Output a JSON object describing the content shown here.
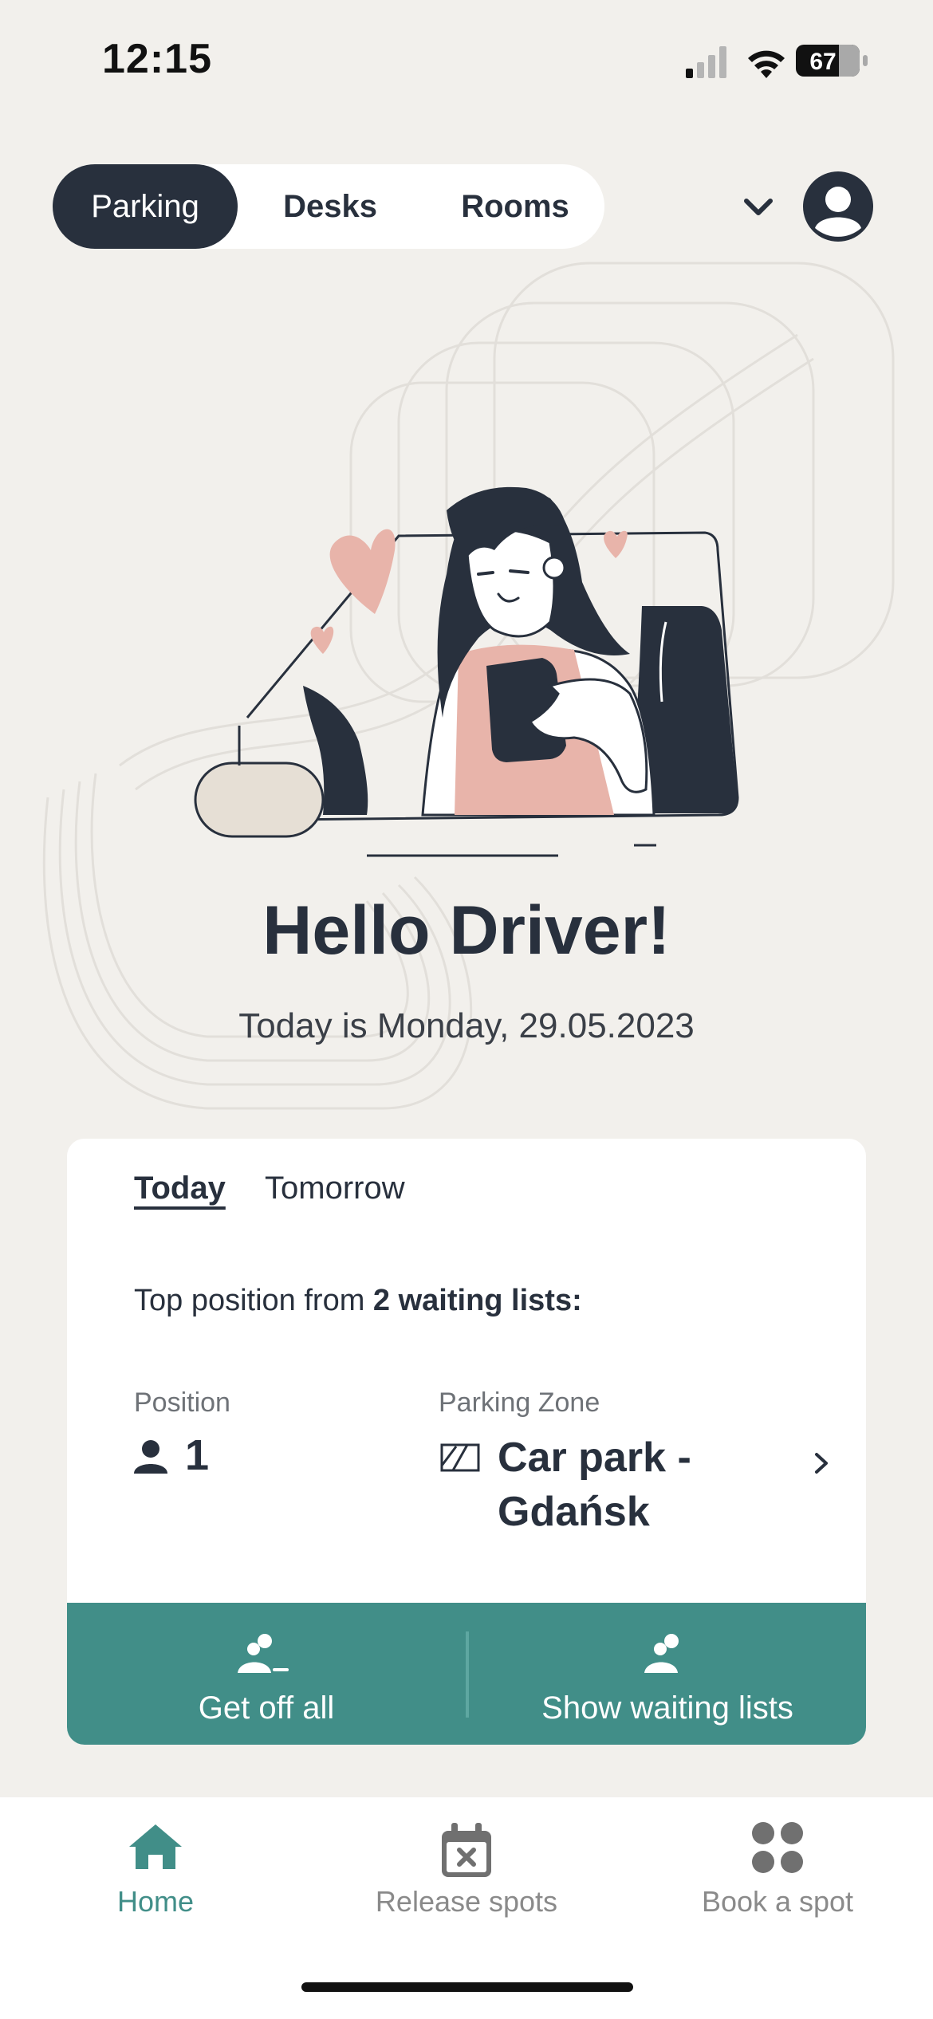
{
  "status_bar": {
    "time": "12:15",
    "battery": "67"
  },
  "header": {
    "tabs": [
      {
        "label": "Parking",
        "active": true
      },
      {
        "label": "Desks",
        "active": false
      },
      {
        "label": "Rooms",
        "active": false
      }
    ]
  },
  "greeting": {
    "title": "Hello Driver!",
    "date_line": "Today is Monday, 29.05.2023"
  },
  "card": {
    "day_tabs": [
      {
        "label": "Today",
        "active": true
      },
      {
        "label": "Tomorrow",
        "active": false
      }
    ],
    "top_position_prefix": "Top position from ",
    "top_position_bold": "2 waiting lists:",
    "position_label": "Position",
    "position_value": "1",
    "zone_label": "Parking Zone",
    "zone_value": "Car park - Gdańsk",
    "actions": {
      "get_off_all": "Get off all",
      "show_waiting_lists": "Show waiting lists"
    }
  },
  "bottom_nav": {
    "items": [
      {
        "label": "Home",
        "active": true
      },
      {
        "label": "Release spots",
        "active": false
      },
      {
        "label": "Book a spot",
        "active": false
      }
    ]
  },
  "colors": {
    "dark": "#28303D",
    "accent": "#418E88",
    "background": "#F2F0EC",
    "pink": "#E8B4AA"
  }
}
